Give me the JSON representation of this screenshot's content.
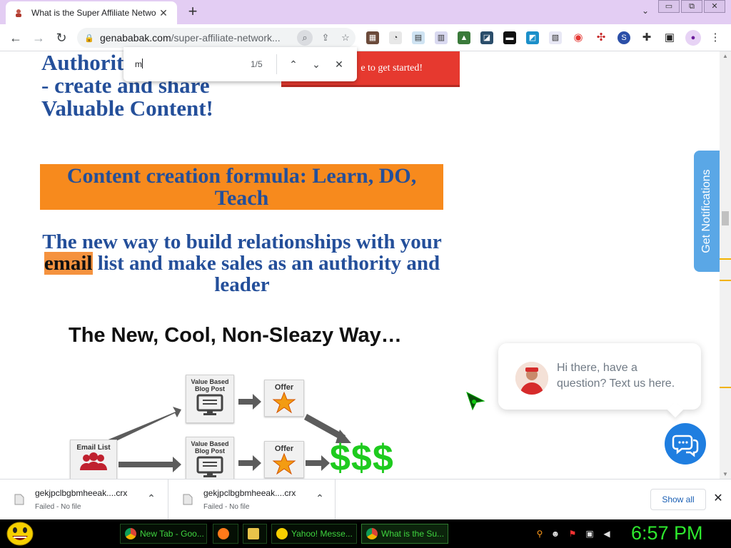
{
  "browser": {
    "tab": {
      "title": "What is the Super Affiliate Netwo"
    },
    "new_tab_symbol": "+",
    "window_controls": [
      "▭",
      "⧉",
      "✕"
    ],
    "address": {
      "host": "genababak.com",
      "path": "/super-affiliate-network..."
    }
  },
  "find_bar": {
    "query": "m",
    "count": "1/5"
  },
  "page": {
    "authority_heading": [
      "Authorit",
      "- create and share",
      "Valuable Content!"
    ],
    "cta_button": "e to get started!",
    "orange_banner": "Content creation formula: Learn, DO, Teach",
    "relationship_heading": {
      "before": "The new way to build relationships with your ",
      "highlight": "email",
      "after": " list and make sales as an authority and leader"
    },
    "cool_heading": "The New, Cool, Non-Sleazy Way…",
    "diagram": {
      "email_list": "Email List",
      "blog_post_1": [
        "Value Based",
        "Blog Post"
      ],
      "blog_post_2": [
        "Value Based",
        "Blog Post"
      ],
      "offer_1": "Offer",
      "offer_2": "Offer",
      "money": "$$$"
    },
    "get_notifications": "Get Notifications",
    "chat_message": "Hi there, have a question? Text us here."
  },
  "downloads": {
    "items": [
      {
        "name": "gekjpclbgbmheeak....crx",
        "status": "Failed - No file"
      },
      {
        "name": "gekjpclbgbmheeak....crx",
        "status": "Failed - No file"
      }
    ],
    "show_all": "Show all"
  },
  "taskbar": {
    "buttons": [
      {
        "label": "New Tab - Goo...",
        "icon": "chrome-icon"
      },
      {
        "label": "",
        "icon": "firefox-icon"
      },
      {
        "label": "",
        "icon": "folder-icon"
      },
      {
        "label": "Yahoo! Messe...",
        "icon": "yahoo-messenger-icon"
      },
      {
        "label": "What is the Su...",
        "icon": "chrome-icon"
      }
    ],
    "clock": "6:57 PM"
  },
  "colors": {
    "tab_strip": "#e3cdf3",
    "heading_blue": "#244f9a",
    "orange_banner": "#f78a1d",
    "cta_red": "#e6392f",
    "money_green": "#1ecb1e",
    "notify_blue": "#5aa7e6",
    "chat_blue": "#1f7ee0",
    "taskbar_green": "#2ee82e"
  }
}
